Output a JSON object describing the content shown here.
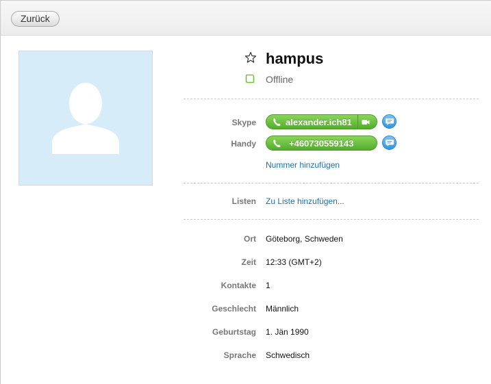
{
  "toolbar": {
    "back_label": "Zurück"
  },
  "contact": {
    "name": "hampus",
    "status": "Offline"
  },
  "contact_methods": {
    "skype_label": "Skype",
    "skype_value": "alexander.ich81",
    "mobile_label": "Handy",
    "mobile_value": "+460730559143",
    "add_number_link": "Nummer hinzufügen"
  },
  "lists": {
    "label": "Listen",
    "add_link": "Zu Liste hinzufügen..."
  },
  "details": [
    {
      "label": "Ort",
      "value": "Göteborg, Schweden"
    },
    {
      "label": "Zeit",
      "value": "12:33 (GMT+2)"
    },
    {
      "label": "Kontakte",
      "value": "1"
    },
    {
      "label": "Geschlecht",
      "value": "Männlich"
    },
    {
      "label": "Geburtstag",
      "value": "1. Jän 1990"
    },
    {
      "label": "Sprache",
      "value": "Schwedisch"
    }
  ],
  "colors": {
    "call_green": "#5db432",
    "chat_blue": "#3a9de3",
    "link_blue": "#1a6fb5",
    "status_green": "#6fc33b"
  }
}
